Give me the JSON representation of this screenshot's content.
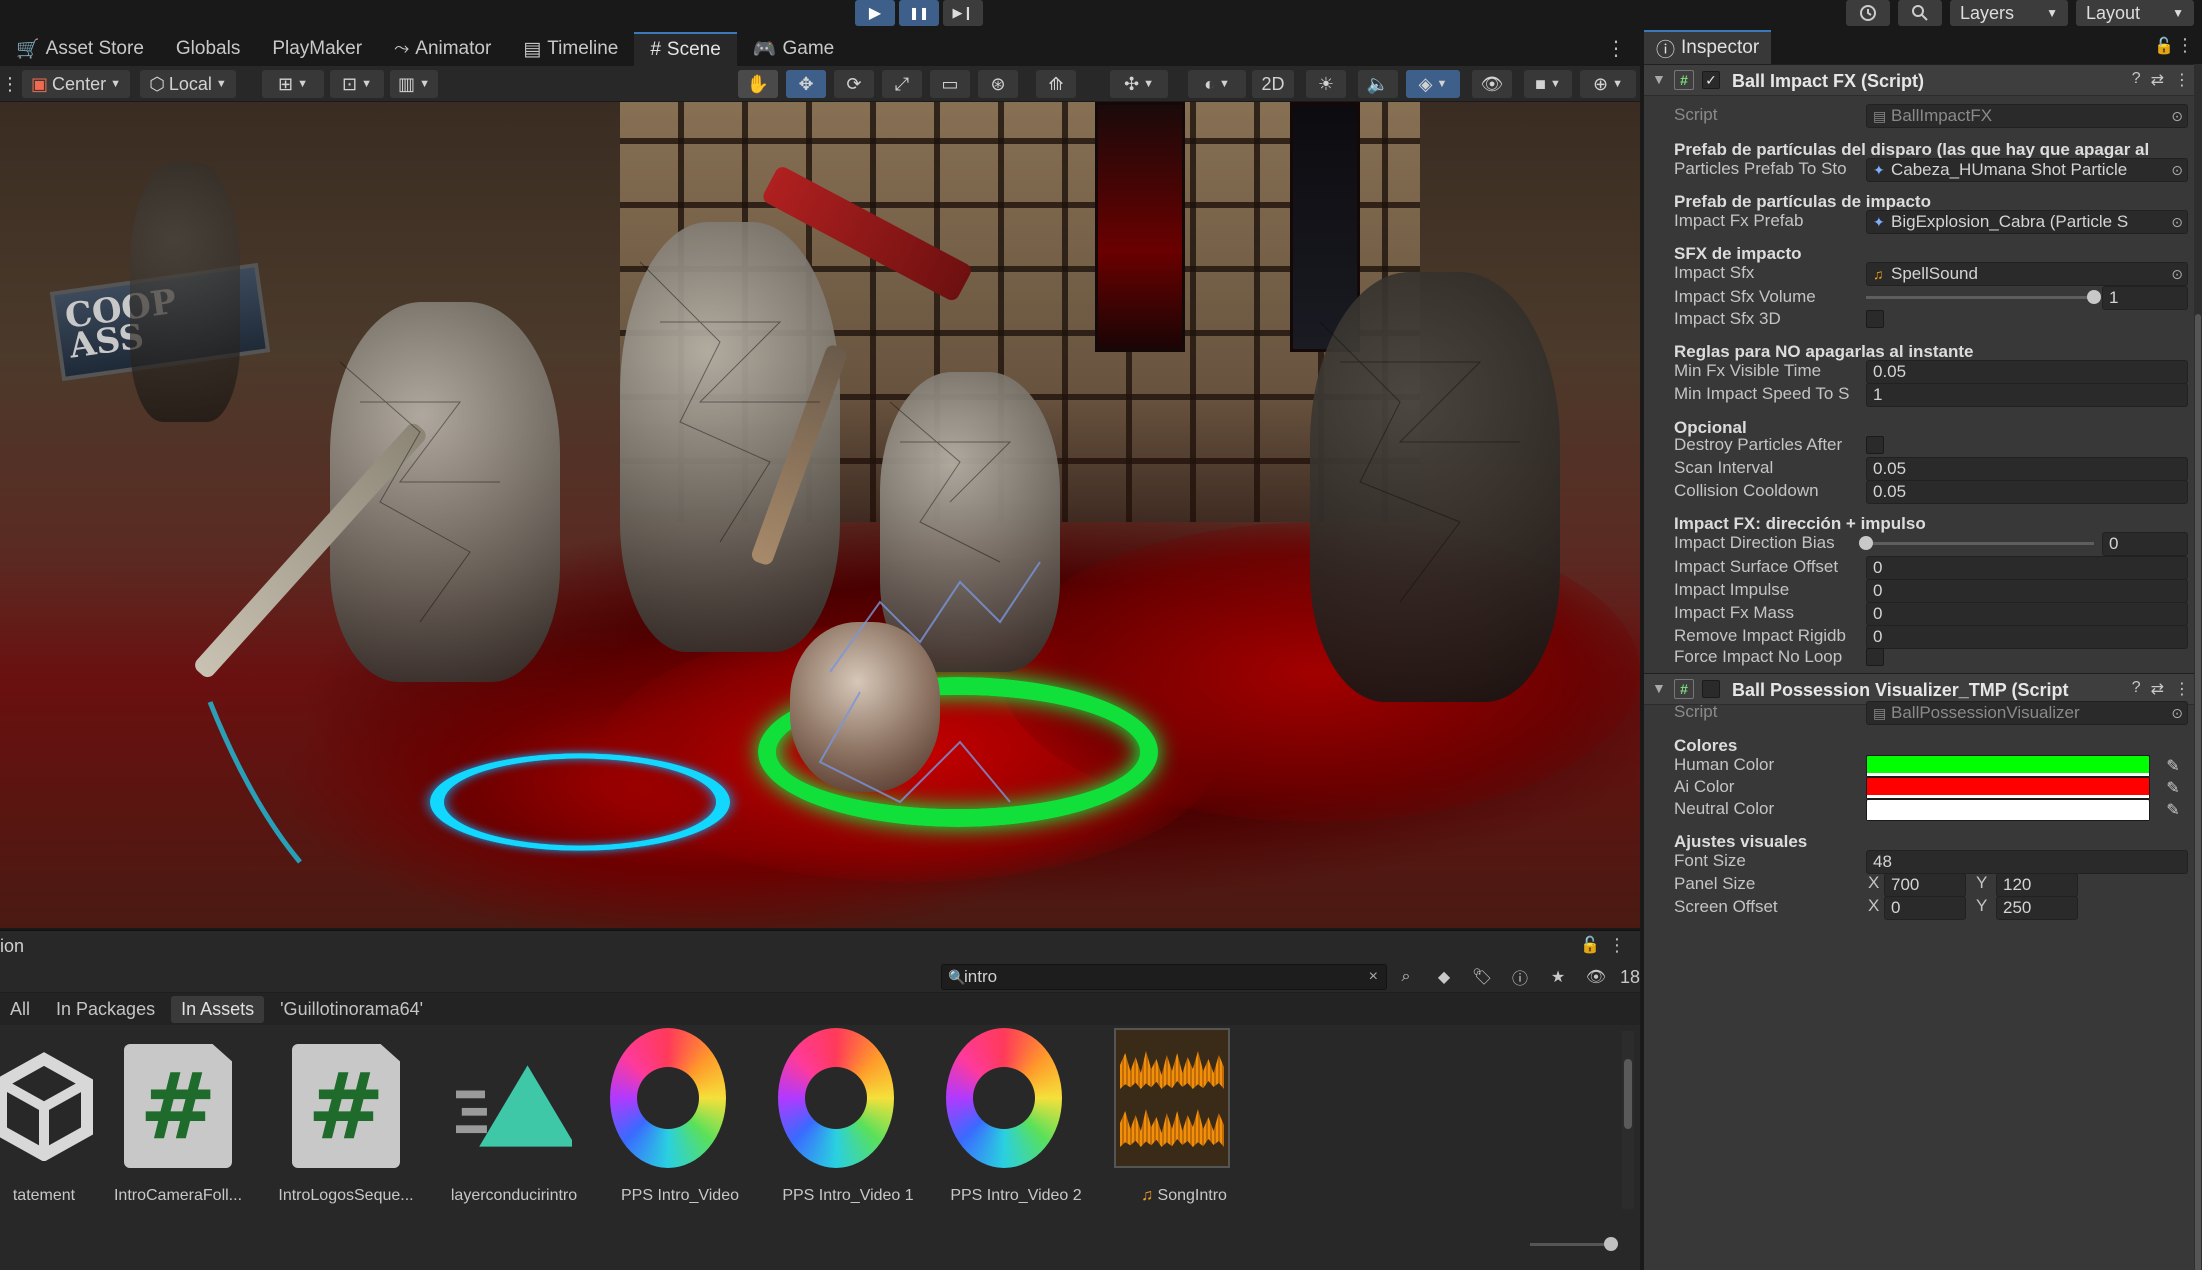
{
  "playbar": {
    "play_icon": "▶",
    "pause_icon": "❚❚",
    "step_icon": "▶❙",
    "history_icon": "history-icon",
    "search_icon": "search-icon",
    "layers_label": "Layers",
    "layout_label": "Layout"
  },
  "tabs": [
    {
      "label": "Asset Store",
      "icon": "store-icon"
    },
    {
      "label": "Globals",
      "icon": ""
    },
    {
      "label": "PlayMaker",
      "icon": ""
    },
    {
      "label": "Animator",
      "icon": "animator-icon"
    },
    {
      "label": "Timeline",
      "icon": "timeline-icon"
    },
    {
      "label": "Scene",
      "icon": "scene-icon"
    },
    {
      "label": "Game",
      "icon": "game-icon"
    }
  ],
  "scene_toolbar": {
    "pivot_label": "Center",
    "space_label": "Local",
    "mode_2d": "2D"
  },
  "scene": {
    "sign_text": "COOP\nASS"
  },
  "project": {
    "title": "ion",
    "search_value": "intro",
    "hidden_count": "18",
    "filters": [
      "All",
      "In Packages",
      "In Assets",
      "'Guillotinorama64'"
    ],
    "active_filter": "In Assets",
    "assets": [
      {
        "label": "tatement",
        "kind": "unity"
      },
      {
        "label": "IntroCameraFoll...",
        "kind": "script"
      },
      {
        "label": "IntroLogosSeque...",
        "kind": "script"
      },
      {
        "label": "layerconducirintro",
        "kind": "tree"
      },
      {
        "label": "PPS Intro_Video",
        "kind": "pps"
      },
      {
        "label": "PPS Intro_Video 1",
        "kind": "pps"
      },
      {
        "label": "PPS Intro_Video 2",
        "kind": "pps"
      },
      {
        "label": "SongIntro",
        "kind": "audio"
      }
    ]
  },
  "inspector": {
    "tab_label": "Inspector",
    "component1": {
      "title": "Ball Impact FX (Script)",
      "enabled": true,
      "script_label": "Script",
      "script_value": "BallImpactFX",
      "h1": "Prefab de partículas del disparo (las que hay que apagar al",
      "particles_label": "Particles Prefab To Sto",
      "particles_value": "Cabeza_HUmana Shot Particle",
      "h2": "Prefab de partículas de impacto",
      "impact_prefab_label": "Impact Fx Prefab",
      "impact_prefab_value": "BigExplosion_Cabra (Particle S",
      "h3": "SFX de impacto",
      "impact_sfx_label": "Impact Sfx",
      "impact_sfx_value": "SpellSound",
      "impact_sfx_volume_label": "Impact Sfx Volume",
      "impact_sfx_volume_value": "1",
      "impact_sfx_volume_fraction": 1.0,
      "impact_sfx_3d_label": "Impact Sfx 3D",
      "h4": "Reglas para NO apagarlas al instante",
      "min_fx_label": "Min Fx Visible Time",
      "min_fx_value": "0.05",
      "min_speed_label": "Min Impact Speed To S",
      "min_speed_value": "1",
      "h5": "Opcional",
      "destroy_label": "Destroy Particles After",
      "scan_label": "Scan Interval",
      "scan_value": "0.05",
      "cooldown_label": "Collision Cooldown",
      "cooldown_value": "0.05",
      "h6": "Impact FX: dirección + impulso",
      "dir_bias_label": "Impact Direction Bias",
      "dir_bias_value": "0",
      "dir_bias_fraction": 0.0,
      "surface_offset_label": "Impact Surface Offset",
      "surface_offset_value": "0",
      "impulse_label": "Impact Impulse",
      "impulse_value": "0",
      "mass_label": "Impact Fx Mass",
      "mass_value": "0",
      "remove_rb_label": "Remove Impact Rigidb",
      "remove_rb_value": "0",
      "force_noloop_label": "Force Impact No Loop"
    },
    "component2": {
      "title": "Ball Possession Visualizer_TMP (Script",
      "enabled": false,
      "script_label": "Script",
      "script_value": "BallPossessionVisualizer",
      "h1": "Colores",
      "human_label": "Human Color",
      "human_color": "#00ff00",
      "ai_label": "Ai Color",
      "ai_color": "#ff0000",
      "neutral_label": "Neutral Color",
      "neutral_color": "#ffffff",
      "h2": "Ajustes visuales",
      "font_size_label": "Font Size",
      "font_size_value": "48",
      "panel_size_label": "Panel Size",
      "panel_x": "700",
      "panel_y": "120",
      "screen_offset_label": "Screen Offset",
      "offset_x": "0",
      "offset_y": "250",
      "x_label": "X",
      "y_label": "Y"
    }
  }
}
